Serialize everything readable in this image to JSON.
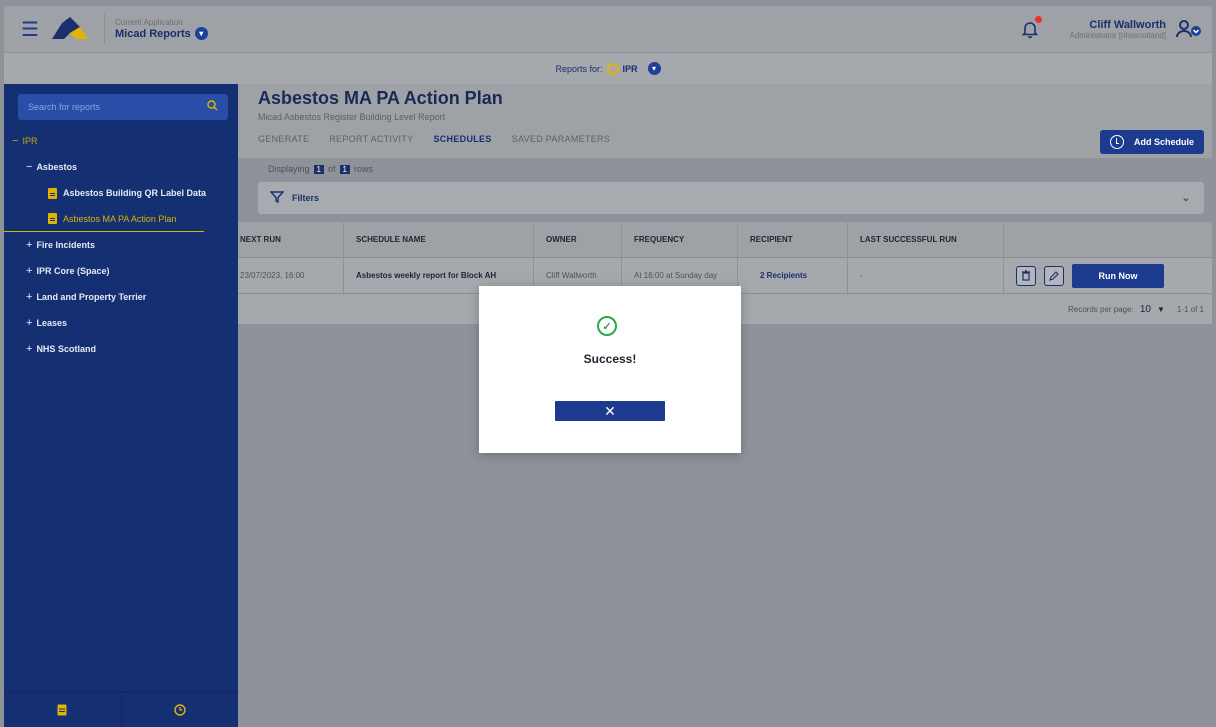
{
  "topbar": {
    "app_caption": "Current Application",
    "app_name": "Micad Reports",
    "user_name": "Cliff Wallworth",
    "user_role": "Administrator [nhsscotland]"
  },
  "reports_bar": {
    "label": "Reports for:",
    "value": "IPR"
  },
  "sidebar": {
    "search_placeholder": "Search for reports",
    "root": "IPR",
    "asbestos": "Asbestos",
    "asbestos_items": [
      "Asbestos Building QR Label Data",
      "Asbestos MA PA Action Plan"
    ],
    "groups": [
      "Fire Incidents",
      "IPR Core (Space)",
      "Land and Property Terrier",
      "Leases",
      "NHS Scotland"
    ]
  },
  "page": {
    "title": "Asbestos MA PA Action Plan",
    "subtitle": "Micad Asbestos Register Building Level Report",
    "tabs": [
      "GENERATE",
      "REPORT ACTIVITY",
      "SCHEDULES",
      "SAVED PARAMETERS"
    ],
    "add_schedule": "Add Schedule"
  },
  "displaying": {
    "prefix": "Displaying",
    "shown": "1",
    "of": "of",
    "total": "1",
    "suffix": "rows"
  },
  "filters_label": "Filters",
  "table": {
    "headers": [
      "NEXT RUN",
      "SCHEDULE NAME",
      "OWNER",
      "FREQUENCY",
      "RECIPIENT",
      "LAST SUCCESSFUL RUN"
    ],
    "row": {
      "next_run": "23/07/2023, 16:00",
      "schedule_name": "Asbestos weekly report for Block AH",
      "owner": "Cliff Wallworth",
      "frequency": "At 16:00 at Sunday day",
      "recipient": "2 Recipients",
      "last_run": "-",
      "run_now": "Run Now"
    }
  },
  "pager": {
    "label": "Records per page:",
    "per_page": "10",
    "range": "1-1 of 1"
  },
  "modal": {
    "message": "Success!",
    "close": "✕"
  }
}
